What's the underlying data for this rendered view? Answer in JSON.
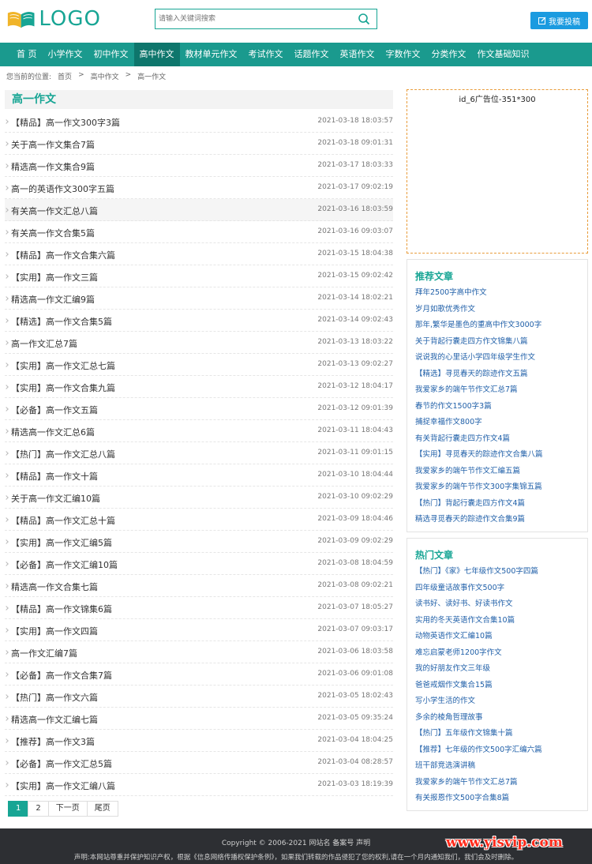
{
  "header": {
    "logo_text": "LOGO",
    "search_placeholder": "请输入关键词搜索",
    "post_button": "我要投稿"
  },
  "nav": {
    "items": [
      "首 页",
      "小学作文",
      "初中作文",
      "高中作文",
      "教材单元作文",
      "考试作文",
      "话题作文",
      "英语作文",
      "字数作文",
      "分类作文",
      "作文基础知识"
    ],
    "active_index": 3
  },
  "breadcrumb": {
    "prefix": "您当前的位置:",
    "items": [
      "首页",
      ">",
      "高中作文",
      ">",
      "高一作文"
    ]
  },
  "main": {
    "title": "高一作文",
    "articles": [
      {
        "title": "【精品】高一作文300字3篇",
        "date": "2021-03-18 18:03:57"
      },
      {
        "title": "关于高一作文集合7篇",
        "date": "2021-03-18 09:01:31"
      },
      {
        "title": "精选高一作文集合9篇",
        "date": "2021-03-17 18:03:33"
      },
      {
        "title": "高一的英语作文300字五篇",
        "date": "2021-03-17 09:02:19"
      },
      {
        "title": "有关高一作文汇总八篇",
        "date": "2021-03-16 18:03:59"
      },
      {
        "title": "有关高一作文合集5篇",
        "date": "2021-03-16 09:03:07"
      },
      {
        "title": "【精品】高一作文合集六篇",
        "date": "2021-03-15 18:04:38"
      },
      {
        "title": "【实用】高一作文三篇",
        "date": "2021-03-15 09:02:42"
      },
      {
        "title": "精选高一作文汇编9篇",
        "date": "2021-03-14 18:02:21"
      },
      {
        "title": "【精选】高一作文合集5篇",
        "date": "2021-03-14 09:02:43"
      },
      {
        "title": "高一作文汇总7篇",
        "date": "2021-03-13 18:03:22"
      },
      {
        "title": "【实用】高一作文汇总七篇",
        "date": "2021-03-13 09:02:27"
      },
      {
        "title": "【实用】高一作文合集九篇",
        "date": "2021-03-12 18:04:17"
      },
      {
        "title": "【必备】高一作文五篇",
        "date": "2021-03-12 09:01:39"
      },
      {
        "title": "精选高一作文汇总6篇",
        "date": "2021-03-11 18:04:43"
      },
      {
        "title": "【热门】高一作文汇总八篇",
        "date": "2021-03-11 09:01:15"
      },
      {
        "title": "【精品】高一作文十篇",
        "date": "2021-03-10 18:04:44"
      },
      {
        "title": "关于高一作文汇编10篇",
        "date": "2021-03-10 09:02:29"
      },
      {
        "title": "【精品】高一作文汇总十篇",
        "date": "2021-03-09 18:04:46"
      },
      {
        "title": "【实用】高一作文汇编5篇",
        "date": "2021-03-09 09:02:29"
      },
      {
        "title": "【必备】高一作文汇编10篇",
        "date": "2021-03-08 18:04:59"
      },
      {
        "title": "精选高一作文合集七篇",
        "date": "2021-03-08 09:02:21"
      },
      {
        "title": "【精品】高一作文锦集6篇",
        "date": "2021-03-07 18:05:27"
      },
      {
        "title": "【实用】高一作文四篇",
        "date": "2021-03-07 09:03:17"
      },
      {
        "title": "高一作文汇编7篇",
        "date": "2021-03-06 18:03:58"
      },
      {
        "title": "【必备】高一作文合集7篇",
        "date": "2021-03-06 09:01:08"
      },
      {
        "title": "【热门】高一作文六篇",
        "date": "2021-03-05 18:02:43"
      },
      {
        "title": "精选高一作文汇编七篇",
        "date": "2021-03-05 09:35:24"
      },
      {
        "title": "【推荐】高一作文3篇",
        "date": "2021-03-04 18:04:25"
      },
      {
        "title": "【必备】高一作文汇总5篇",
        "date": "2021-03-04 08:28:57"
      },
      {
        "title": "【实用】高一作文汇编八篇",
        "date": "2021-03-03 18:19:39"
      }
    ],
    "highlighted_index": 4
  },
  "pagination": {
    "pages": [
      "1",
      "2",
      "下一页",
      "尾页"
    ],
    "current": "1"
  },
  "ad": {
    "label": "id_6广告位-351*300"
  },
  "recommended": {
    "title": "推荐文章",
    "links": [
      "拜年2500字高中作文",
      "岁月如歌优秀作文",
      "那年,繁华是墨色的重高中作文3000字",
      "关于背起行囊走四方作文锦集八篇",
      "说说我的心里话小学四年级学生作文",
      "【精选】寻觅春天的踪迹作文五篇",
      "我爱家乡的端午节作文汇总7篇",
      "春节的作文1500字3篇",
      "捕捉幸福作文800字",
      "有关背起行囊走四方作文4篇",
      "【实用】寻觅春天的踪迹作文合集八篇",
      "我爱家乡的端午节作文汇编五篇",
      "我爱家乡的端午节作文300字集锦五篇",
      "【热门】背起行囊走四方作文4篇",
      "精选寻觅春天的踪迹作文合集9篇"
    ]
  },
  "hot": {
    "title": "热门文章",
    "links": [
      "【热门】《家》七年级作文500字四篇",
      "四年级童话故事作文500字",
      "读书好、读好书、好读书作文",
      "实用的冬天英语作文合集10篇",
      "动物英语作文汇编10篇",
      "难忘启蒙老师1200字作文",
      "我的好朋友作文三年级",
      "爸爸戒烟作文集合15篇",
      "写小学生活的作文",
      "多余的棱角哲理故事",
      "【热门】五年级作文锦集十篇",
      "【推荐】七年级的作文500字汇编六篇",
      "班干部竞选演讲稿",
      "我爱家乡的端午节作文汇总7篇",
      "有关报恩作文500字合集8篇"
    ]
  },
  "footer": {
    "copyright": "Copyright © 2006-2021 网站名 备案号 声明",
    "notice": "声明:本网站尊重并保护知识产权，根据《信息网络传播权保护条例》，如果我们转载的作品侵犯了您的权利,请在一个月内通知我们，我们会及时删除。",
    "watermark": "www.yisvip.com"
  },
  "colors": {
    "brand": "#17a594",
    "nav_bg": "#1a9a8e",
    "nav_active": "#0e766c",
    "link": "#1f5fa8",
    "post_button": "#1b9be0"
  }
}
